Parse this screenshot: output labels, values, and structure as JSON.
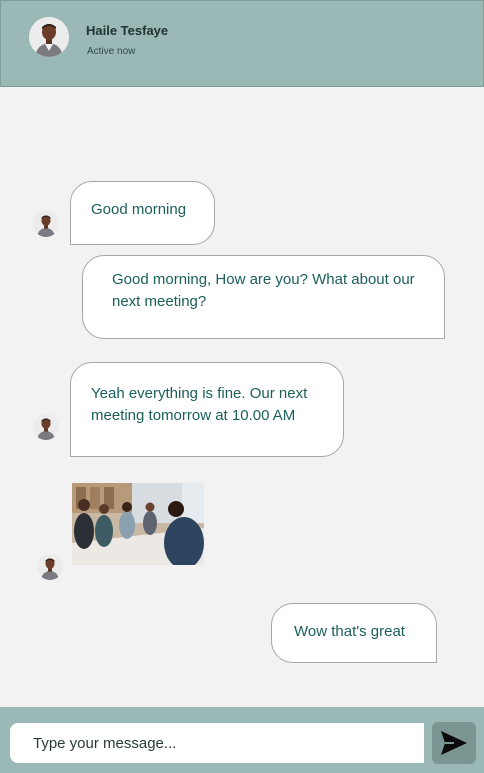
{
  "contact": {
    "name": "Haile Tesfaye",
    "status": "Active now"
  },
  "messages": [
    {
      "direction": "incoming",
      "text": "Good morning"
    },
    {
      "direction": "outgoing",
      "text": "Good morning, How are you? What about our next meeting?"
    },
    {
      "direction": "incoming",
      "text": "Yeah everything is fine. Our next meeting tomorrow at 10.00 AM"
    },
    {
      "direction": "incoming",
      "type": "image",
      "image": "meeting-photo"
    },
    {
      "direction": "outgoing",
      "text": "Wow that's great"
    }
  ],
  "composer": {
    "placeholder": "Type your message...",
    "send_icon": "send-icon"
  },
  "colors": {
    "header_bg": "#9ab8b5",
    "chat_bg": "#f2f2f2",
    "text_teal": "#1a5f5a",
    "send_bg": "#7b9592"
  }
}
